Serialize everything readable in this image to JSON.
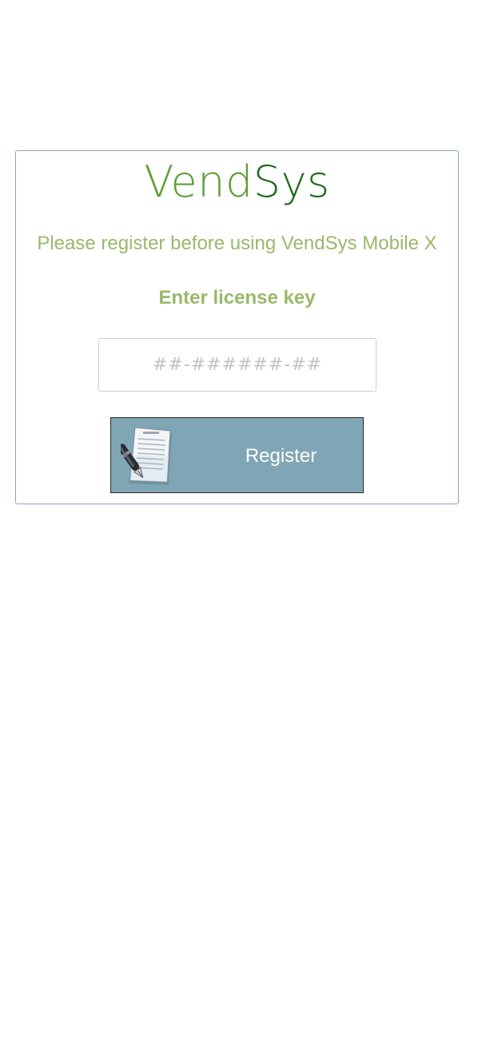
{
  "logo": {
    "part1": "Vend",
    "part2": "Sys",
    "colors": {
      "part1": "#5c9f35",
      "part2": "#1f6a1c"
    }
  },
  "subtitle": "Please register before using VendSys Mobile X",
  "license": {
    "label": "Enter license key",
    "placeholder": "##-######-##",
    "value": ""
  },
  "register_button": {
    "label": "Register",
    "icon": "contract-pen-icon",
    "background": "#80a6b6"
  },
  "accent_color": "#9ab86a"
}
